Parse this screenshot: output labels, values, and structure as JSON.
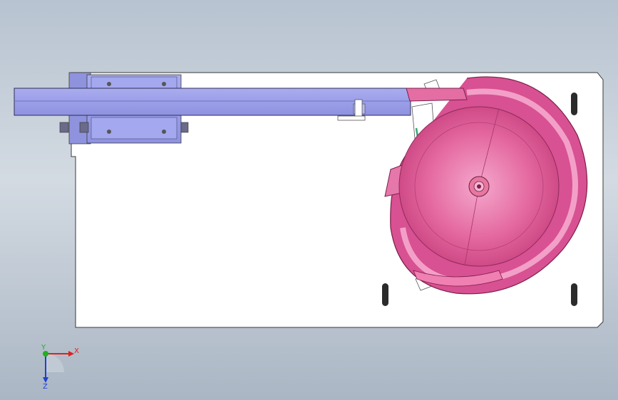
{
  "view": {
    "type": "cad-3d-viewport",
    "orientation": "top",
    "background_top": "#b7c3d0",
    "background_bottom": "#aab6c4"
  },
  "colors": {
    "plate": "#ffffff",
    "plate_edge": "#3a3a3a",
    "rail": "#9a9ee8",
    "rail_dark": "#7c80d4",
    "bowl": "#e0609a",
    "bowl_dark": "#b8326e",
    "bowl_light": "#f19cc3",
    "slot": "#2b2b2b",
    "axis_x": "#e02020",
    "axis_y": "#20b020",
    "axis_z": "#2040d0"
  },
  "triad": {
    "x_label": "X",
    "y_label": "Y",
    "z_label": "Z"
  },
  "icons": {
    "triad": "coordinate-triad-icon"
  }
}
